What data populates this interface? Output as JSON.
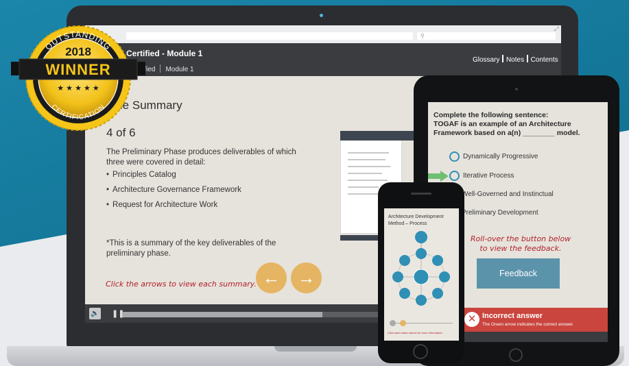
{
  "badge": {
    "arc_top": "OUTSTANDING",
    "year": "2018",
    "ribbon": "WINNER",
    "arc_bottom": "CERTIFICATION"
  },
  "course": {
    "title": "Certified - Module 1",
    "breadcrumb": [
      "rtified",
      "Module 1"
    ],
    "nav": [
      "Glossary",
      "Notes",
      "Contents"
    ]
  },
  "slide": {
    "heading": "dule Summary",
    "counter": "4 of 6",
    "intro": "The Preliminary Phase produces deliverables of which three were covered in detail:",
    "bullets": [
      "Principles Catalog",
      "Architecture Governance Framework",
      "Request for Architecture Work"
    ],
    "footnote": "*This is a summary of the key deliverables of the preliminary phase.",
    "hint": "Click the arrows to view each summary.",
    "prev_symbol": "←",
    "next_symbol": "→"
  },
  "player": {
    "progress": 0.47
  },
  "quiz": {
    "question_line1": "Complete the following sentence:",
    "question_line2": "TOGAF is an example of an Architecture Framework based on a(n) ________ model.",
    "options": [
      "Dynamically Progressive",
      "Iterative Process",
      "Well-Governed and Instinctual",
      "Preliminary Development"
    ],
    "rollover_hint": "Roll-over the button below to view the feedback.",
    "feedback_label": "Feedback",
    "incorrect_title": "Incorrect answer",
    "incorrect_sub": "The Green arrow indicates the correct answer."
  },
  "phone": {
    "title": "Architecture Development Method – Process",
    "footer": "Click each button above for more information."
  },
  "colors": {
    "accent_blue": "#2f8fb5",
    "orange_button": "#e5b564",
    "incorrect_red": "#c9453e",
    "feedback_blue": "#5b93ab",
    "badge_gold": "#f2c21a"
  }
}
